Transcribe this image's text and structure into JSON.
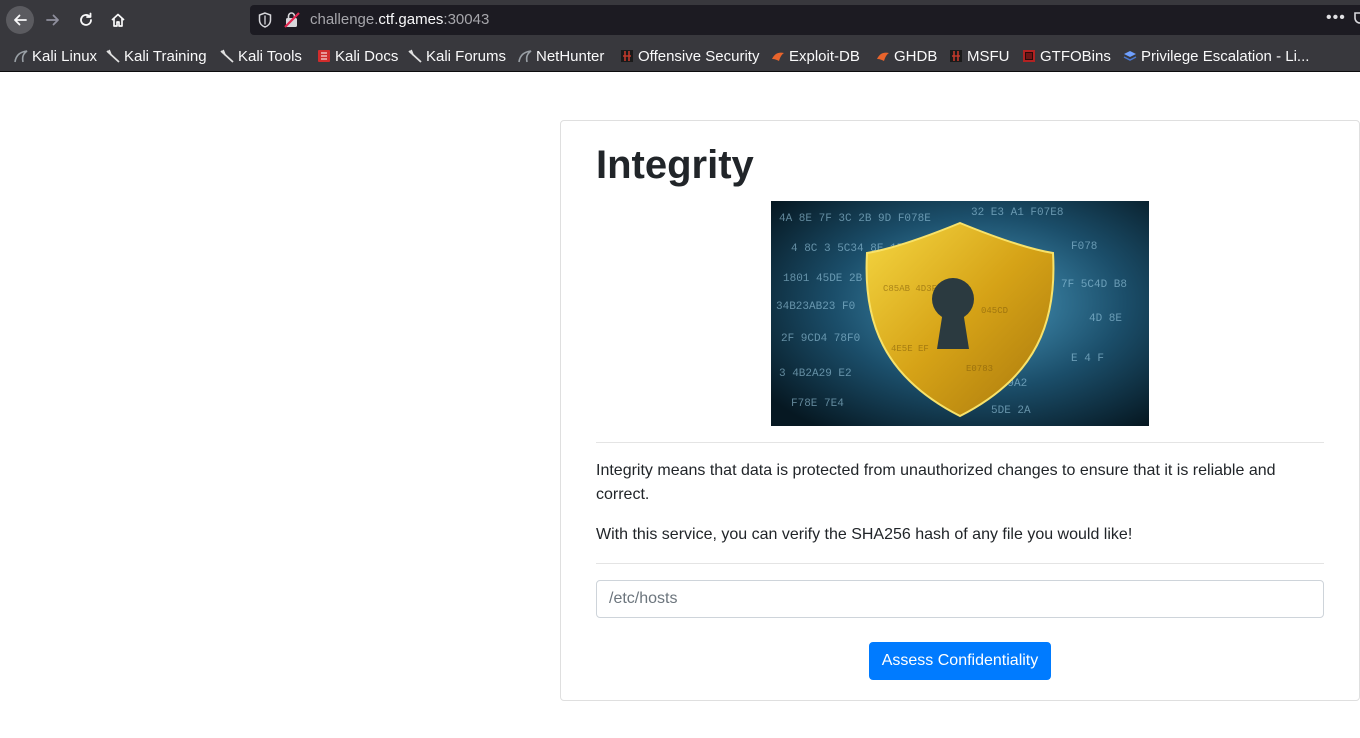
{
  "browser": {
    "url_prefix": "challenge.",
    "url_host": "ctf.games",
    "url_suffix": ":30043",
    "more_menu": "•••"
  },
  "bookmarks": [
    {
      "label": "Kali Linux",
      "icon": "kali-dragon-icon",
      "color": "#9aa0a6"
    },
    {
      "label": "Kali Training",
      "icon": "kali-dragon-icon",
      "color": "#e0e0e0"
    },
    {
      "label": "Kali Tools",
      "icon": "kali-dragon-icon",
      "color": "#e0e0e0"
    },
    {
      "label": "Kali Docs",
      "icon": "kali-docs-icon",
      "color": "#d12c2c"
    },
    {
      "label": "Kali Forums",
      "icon": "kali-dragon-icon",
      "color": "#e0e0e0"
    },
    {
      "label": "NetHunter",
      "icon": "kali-dragon-icon",
      "color": "#9aa0a6"
    },
    {
      "label": "Offensive Security",
      "icon": "offsec-icon",
      "color": "#c0392b"
    },
    {
      "label": "Exploit-DB",
      "icon": "exploit-db-icon",
      "color": "#e8642c"
    },
    {
      "label": "GHDB",
      "icon": "exploit-db-icon",
      "color": "#e8642c"
    },
    {
      "label": "MSFU",
      "icon": "offsec-icon",
      "color": "#c0392b"
    },
    {
      "label": "GTFOBins",
      "icon": "gtfobins-icon",
      "color": "#b22222"
    },
    {
      "label": "Privilege Escalation - Li...",
      "icon": "layers-icon",
      "color": "#4a78d0"
    }
  ],
  "page": {
    "title": "Integrity",
    "paragraph1": "Integrity means that data is protected from unauthorized changes to ensure that it is reliable and correct.",
    "paragraph2": "With this service, you can verify the SHA256 hash of any file you would like!",
    "input_placeholder": "/etc/hosts",
    "input_value": "",
    "submit_label": "Assess Confidentiality"
  },
  "colors": {
    "accent": "#007bff",
    "chrome": "#38383d",
    "urlbar": "#1c1b22"
  }
}
